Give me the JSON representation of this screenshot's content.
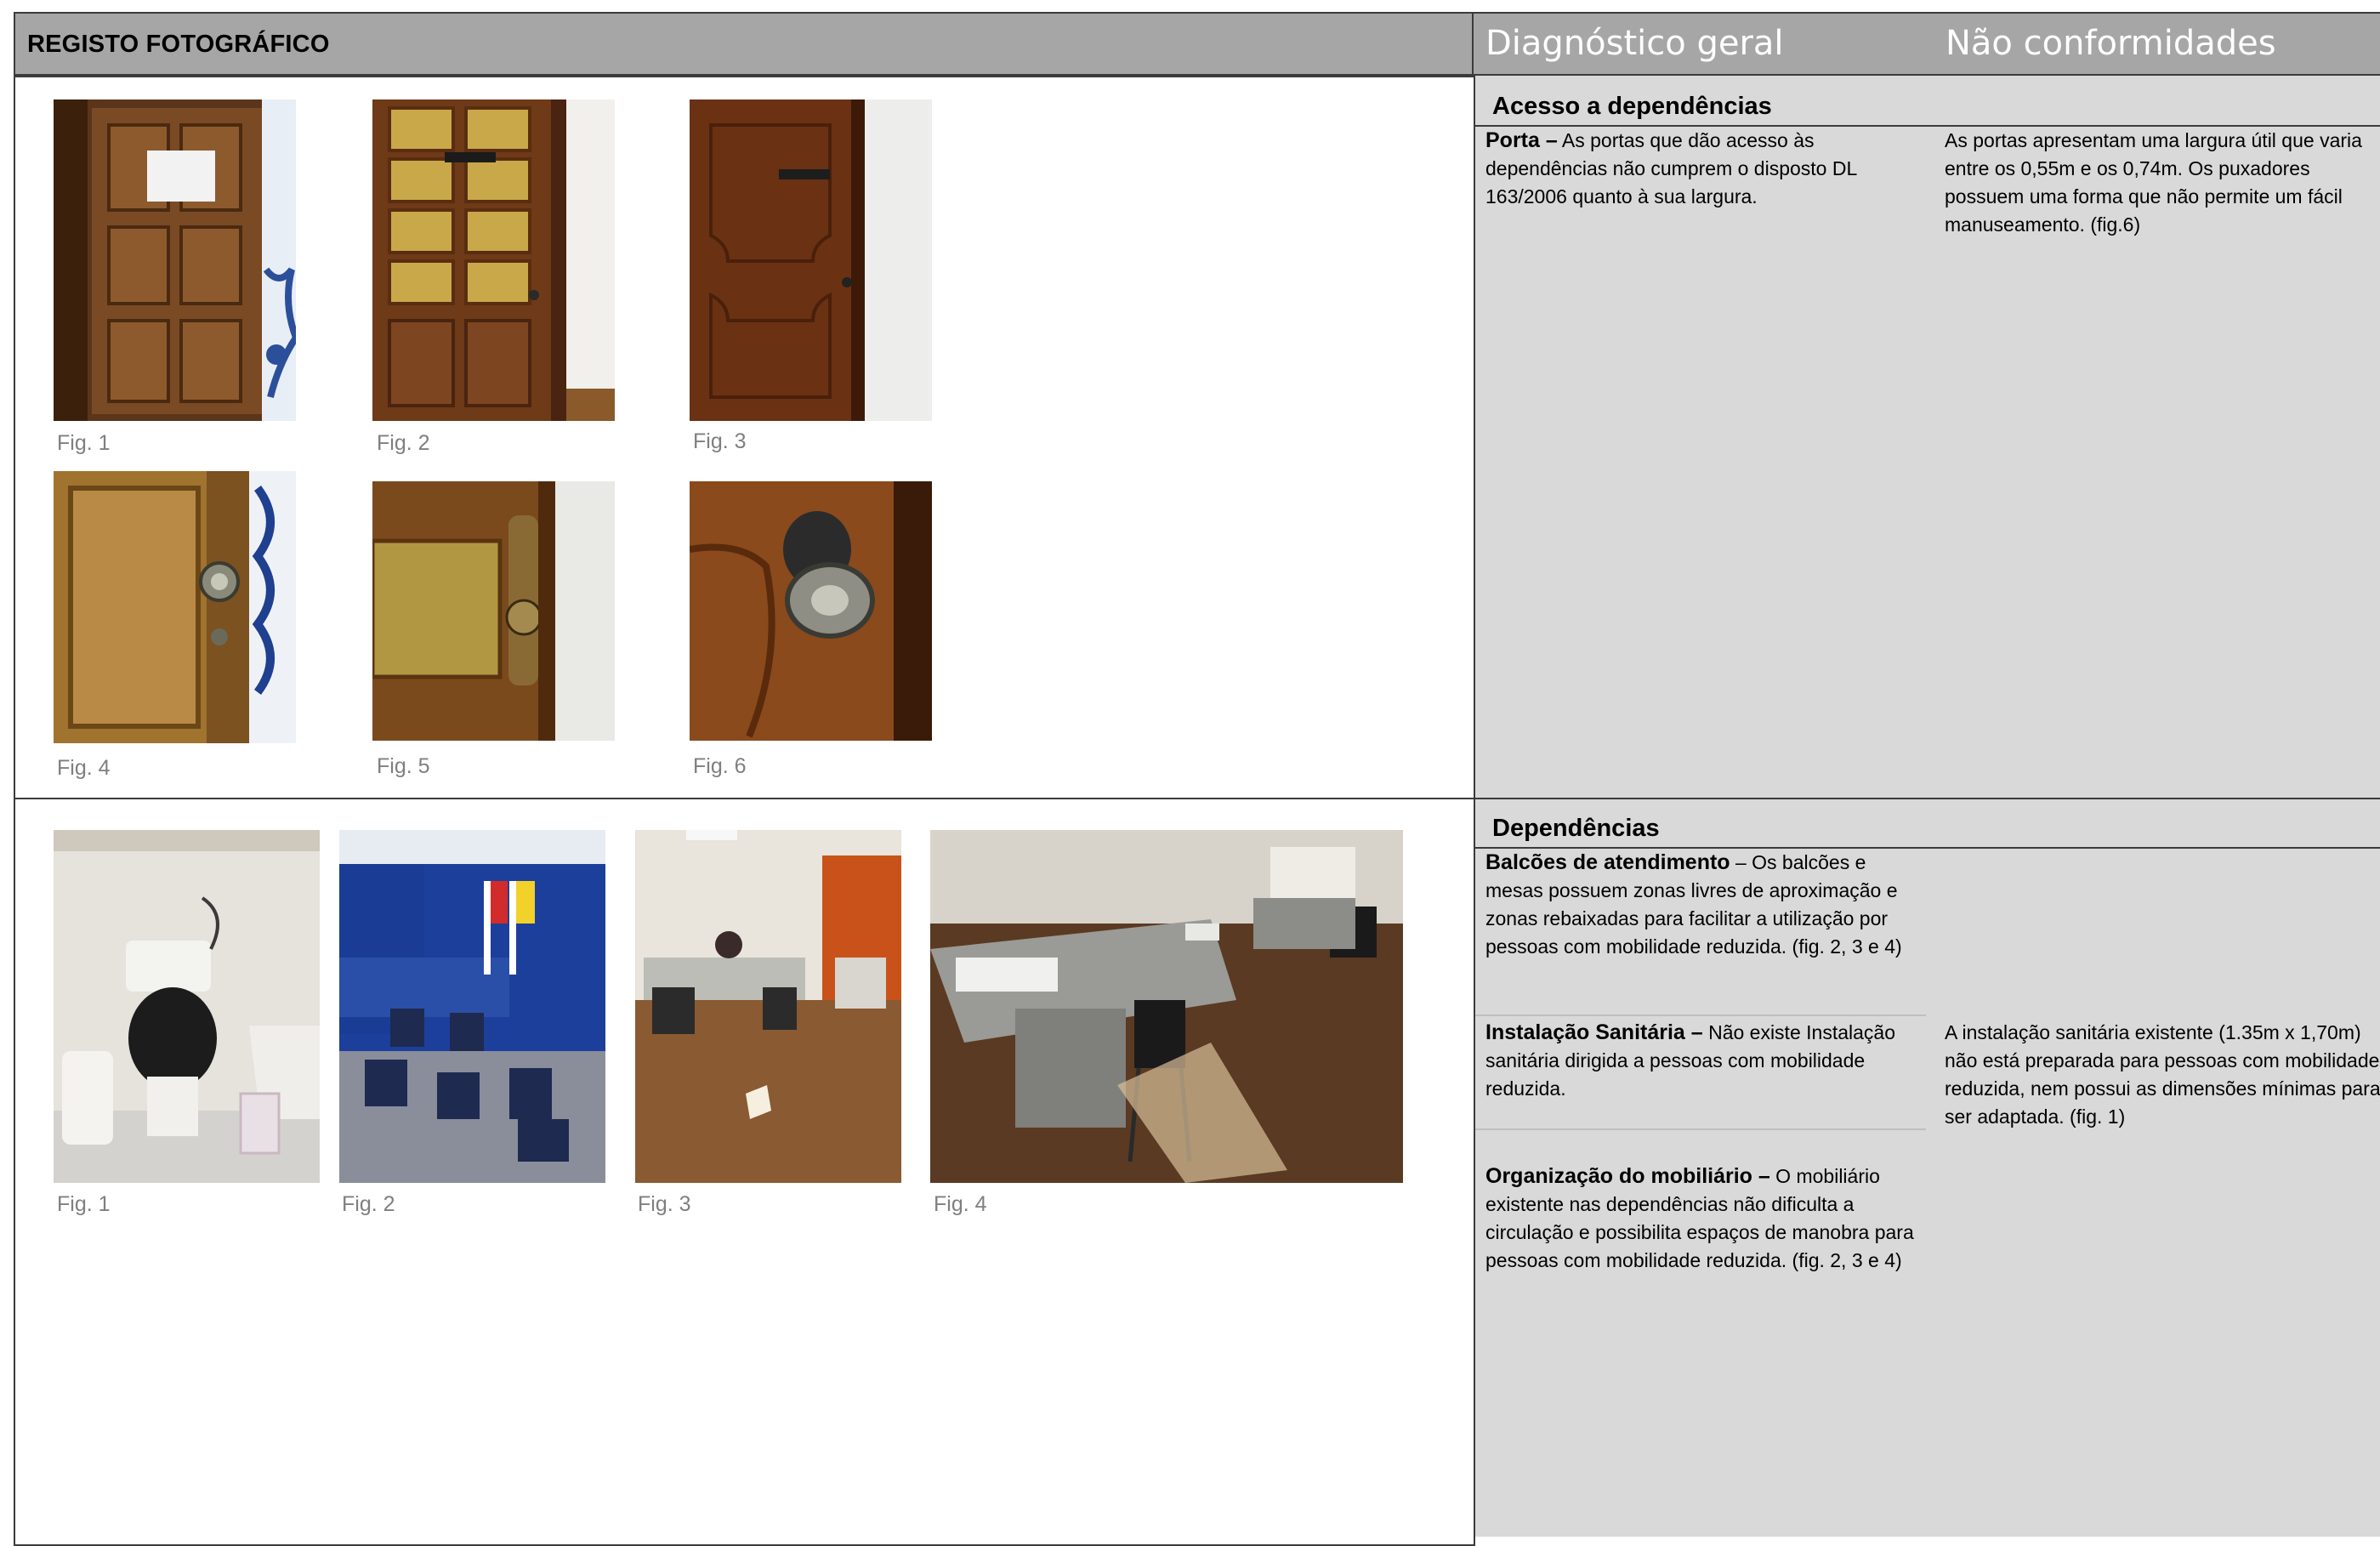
{
  "header": {
    "title": "REGISTO FOTOGRÁFICO",
    "col_diagnostico": "Diagnóstico geral",
    "col_nao_conformidades": "Não conformidades"
  },
  "section1": {
    "title": "Acesso a dependências",
    "diag_bold": "Porta –",
    "diag_text": " As portas que dão acesso às dependências não cumprem o disposto DL 163/2006 quanto à sua largura.",
    "nc_text": "As portas apresentam uma largura útil que varia entre os 0,55m e os 0,74m. Os puxadores possuem uma forma que não permite um fácil manuseamento. (fig.6)",
    "captions": [
      "Fig. 1",
      "Fig. 2",
      "Fig. 3",
      "Fig. 4",
      "Fig. 5",
      "Fig. 6"
    ]
  },
  "section2": {
    "title": "Dependências",
    "item1_bold": "Balcões de atendimento",
    "item1_text": " – Os balcões e mesas possuem zonas livres de aproximação e zonas rebaixadas para facilitar a utilização por pessoas com mobilidade reduzida. (fig. 2, 3 e 4)",
    "item2_bold": "Instalação Sanitária –",
    "item2_text": " Não existe Instalação sanitária dirigida a pessoas com mobilidade reduzida.",
    "item2_nc": "A instalação sanitária existente (1.35m x 1,70m) não está preparada para pessoas com mobilidade reduzida, nem possui as dimensões mínimas para ser adaptada. (fig. 1)",
    "item3_bold": "Organização do mobiliário –",
    "item3_text": " O mobiliário existente nas dependências não dificulta a circulação e possibilita espaços de manobra para pessoas com mobilidade reduzida. (fig. 2, 3 e 4)",
    "captions": [
      "Fig. 1",
      "Fig. 2",
      "Fig. 3",
      "Fig. 4"
    ]
  },
  "colors": {
    "header_bg": "#a6a6a6",
    "right_col_bg": "#d9d9d9",
    "caption": "#7f7f7f",
    "border": "#3b3b3b"
  }
}
